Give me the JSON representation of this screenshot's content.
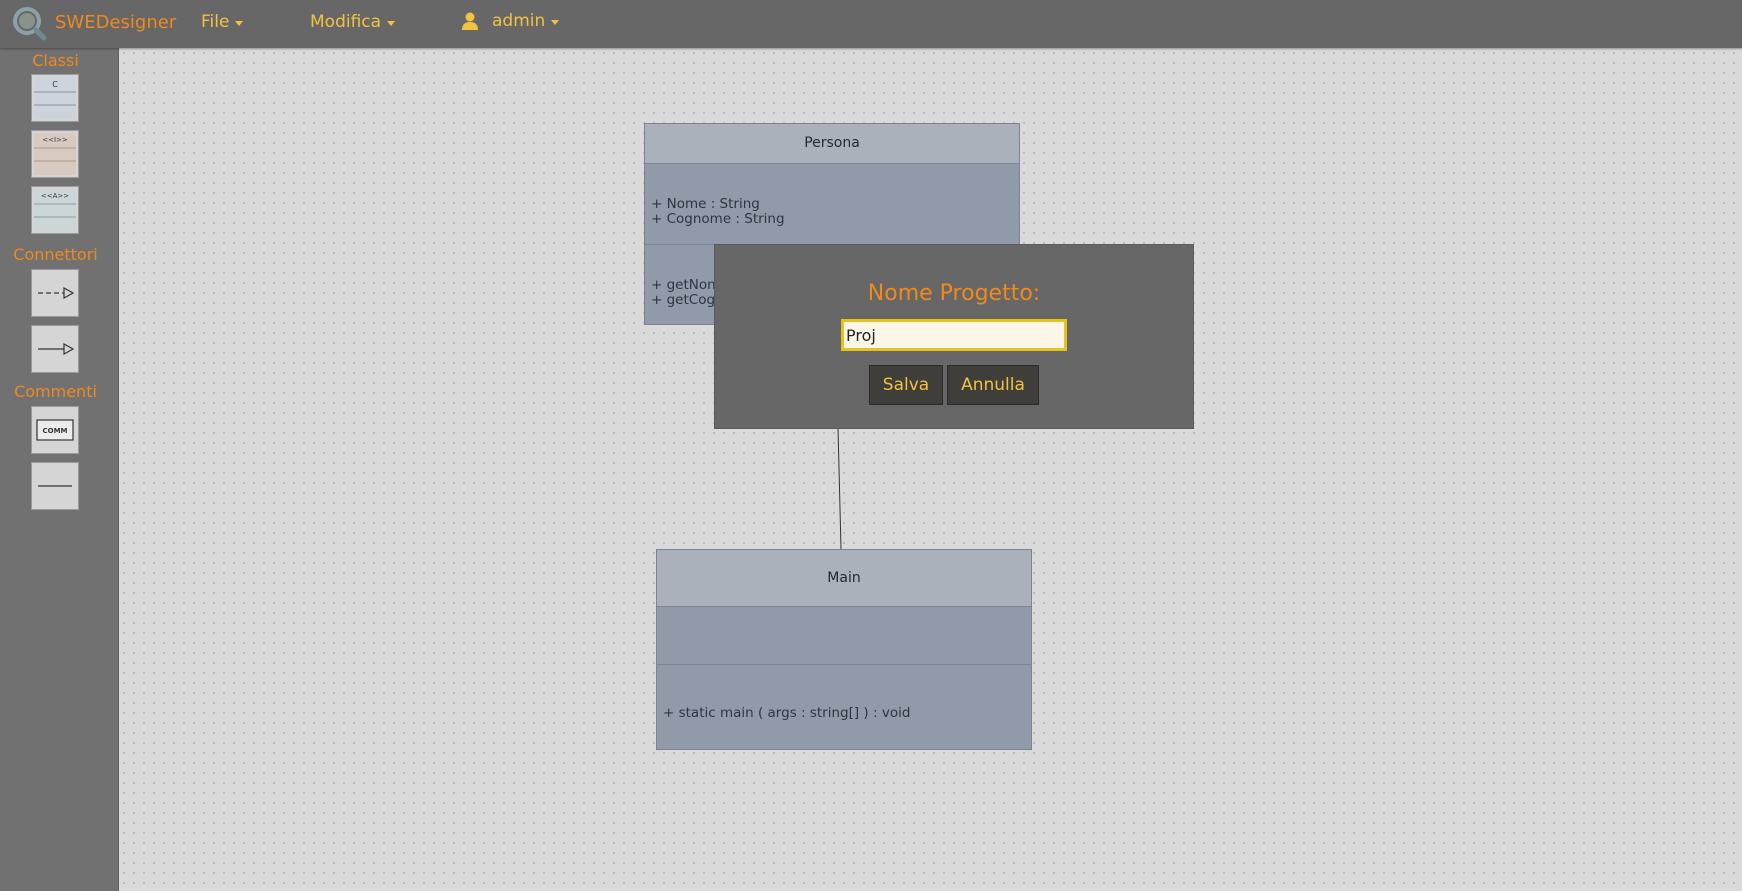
{
  "app": {
    "name": "SWEDesigner"
  },
  "menu": {
    "file": "File",
    "edit": "Modifica",
    "user": "admin"
  },
  "sidebar": {
    "classes_title": "Classi",
    "connectors_title": "Connettori",
    "comments_title": "Commenti",
    "tools": {
      "class_label": "C",
      "interface_label": "<<I>>",
      "abstract_label": "<<A>>",
      "comment_label": "COMM"
    }
  },
  "diagram": {
    "persona": {
      "name": "Persona",
      "attributes": [
        "+ Nome : String",
        "+ Cognome : String"
      ],
      "methods": [
        "+  getNon",
        "+  getCog"
      ]
    },
    "main": {
      "name": "Main",
      "methods": [
        "+ static main ( args : string[] ) : void"
      ]
    }
  },
  "dialog": {
    "title": "Nome Progetto:",
    "input_value": "Proj",
    "save_label": "Salva",
    "cancel_label": "Annulla"
  },
  "colors": {
    "accent_orange": "#f08a1c",
    "accent_yellow": "#f2c341",
    "topbar": "#676767",
    "uml_body": "#919aa8",
    "uml_header": "#aab1bb"
  }
}
